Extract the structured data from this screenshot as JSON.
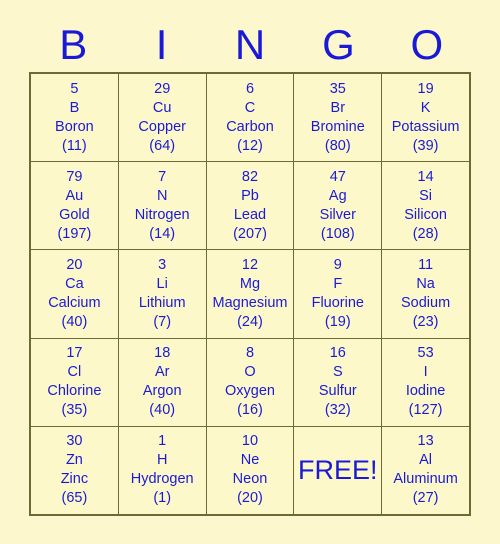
{
  "header": {
    "letters": [
      "B",
      "I",
      "N",
      "G",
      "O"
    ]
  },
  "colors": {
    "background": "#fcf7cd",
    "cell_background": "#fdf8ca",
    "grid_line": "#6d6a35",
    "text": "#1a1ad6"
  },
  "card": {
    "free_label": "FREE!",
    "rows": [
      [
        {
          "number": "5",
          "symbol": "B",
          "name": "Boron",
          "mass": "(11)"
        },
        {
          "number": "29",
          "symbol": "Cu",
          "name": "Copper",
          "mass": "(64)"
        },
        {
          "number": "6",
          "symbol": "C",
          "name": "Carbon",
          "mass": "(12)"
        },
        {
          "number": "35",
          "symbol": "Br",
          "name": "Bromine",
          "mass": "(80)"
        },
        {
          "number": "19",
          "symbol": "K",
          "name": "Potassium",
          "mass": "(39)"
        }
      ],
      [
        {
          "number": "79",
          "symbol": "Au",
          "name": "Gold",
          "mass": "(197)"
        },
        {
          "number": "7",
          "symbol": "N",
          "name": "Nitrogen",
          "mass": "(14)"
        },
        {
          "number": "82",
          "symbol": "Pb",
          "name": "Lead",
          "mass": "(207)"
        },
        {
          "number": "47",
          "symbol": "Ag",
          "name": "Silver",
          "mass": "(108)"
        },
        {
          "number": "14",
          "symbol": "Si",
          "name": "Silicon",
          "mass": "(28)"
        }
      ],
      [
        {
          "number": "20",
          "symbol": "Ca",
          "name": "Calcium",
          "mass": "(40)"
        },
        {
          "number": "3",
          "symbol": "Li",
          "name": "Lithium",
          "mass": "(7)"
        },
        {
          "number": "12",
          "symbol": "Mg",
          "name": "Magnesium",
          "mass": "(24)"
        },
        {
          "number": "9",
          "symbol": "F",
          "name": "Fluorine",
          "mass": "(19)"
        },
        {
          "number": "11",
          "symbol": "Na",
          "name": "Sodium",
          "mass": "(23)"
        }
      ],
      [
        {
          "number": "17",
          "symbol": "Cl",
          "name": "Chlorine",
          "mass": "(35)"
        },
        {
          "number": "18",
          "symbol": "Ar",
          "name": "Argon",
          "mass": "(40)"
        },
        {
          "number": "8",
          "symbol": "O",
          "name": "Oxygen",
          "mass": "(16)"
        },
        {
          "number": "16",
          "symbol": "S",
          "name": "Sulfur",
          "mass": "(32)"
        },
        {
          "number": "53",
          "symbol": "I",
          "name": "Iodine",
          "mass": "(127)"
        }
      ],
      [
        {
          "number": "30",
          "symbol": "Zn",
          "name": "Zinc",
          "mass": "(65)"
        },
        {
          "number": "1",
          "symbol": "H",
          "name": "Hydrogen",
          "mass": "(1)"
        },
        {
          "number": "10",
          "symbol": "Ne",
          "name": "Neon",
          "mass": "(20)"
        },
        {
          "free": true
        },
        {
          "number": "13",
          "symbol": "Al",
          "name": "Aluminum",
          "mass": "(27)"
        }
      ]
    ]
  }
}
